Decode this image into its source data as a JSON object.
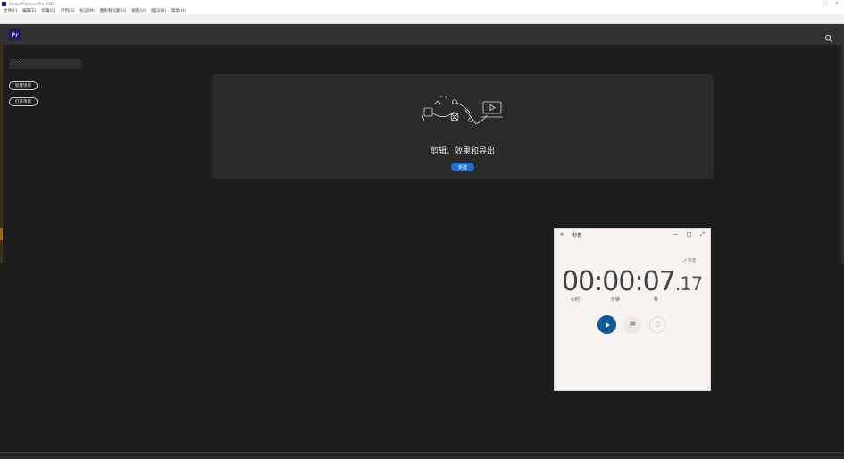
{
  "window": {
    "title": "Adobe Premiere Pro 2023",
    "controls": [
      "□",
      "×"
    ]
  },
  "menu": [
    "文件(F)",
    "编辑(E)",
    "剪辑(C)",
    "序列(S)",
    "标记(M)",
    "图形和标题(G)",
    "视图(V)",
    "窗口(W)",
    "帮助(H)"
  ],
  "header": {
    "logo": "Pr",
    "search_icon": "search-icon"
  },
  "left_panel": {
    "field_value": "•••",
    "new_project": "新建项目",
    "open_project": "打开项目"
  },
  "card": {
    "caption": "剪辑、效果和导出",
    "button": "新建"
  },
  "stopwatch": {
    "menu_icon": "≡",
    "title": "秒表",
    "minimize": "—",
    "maximize": "□",
    "expand": "⤢",
    "lap_info": "⤢ 计次",
    "time_main": "00:00:07",
    "time_ms": ".17",
    "unit_hours": "小时",
    "unit_minutes": "分钟",
    "unit_seconds": "秒",
    "play_icon": "play-icon",
    "flag_icon": "flag-icon",
    "reset_icon": "reset-icon",
    "accent": "#0b5a9e"
  },
  "colors": {
    "app_bg": "#1d1d1d",
    "header_bg": "#323232",
    "card_bg": "#2a2a2a",
    "primary_button": "#1f6ed4"
  }
}
